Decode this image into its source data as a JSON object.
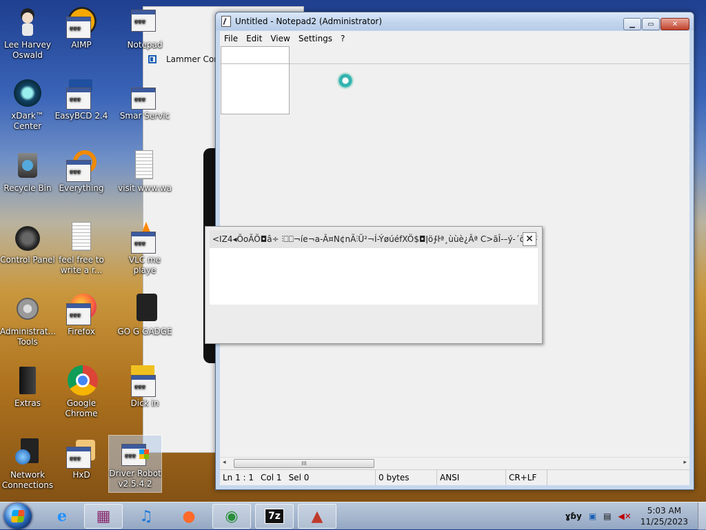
{
  "desktop": {
    "icons": [
      {
        "label": "Lee Harvey Oswald"
      },
      {
        "label": "AIMP"
      },
      {
        "label": "Notepad"
      },
      {
        "label": "xDark™ Center"
      },
      {
        "label": "EasyBCD 2.4"
      },
      {
        "label": "Smar Servic"
      },
      {
        "label": "Recycle Bin"
      },
      {
        "label": "Everything"
      },
      {
        "label": "visit www.wa"
      },
      {
        "label": "Control Panel"
      },
      {
        "label": "feel free to write a r..."
      },
      {
        "label": "VLC me playe"
      },
      {
        "label": "Administrat... Tools"
      },
      {
        "label": "Firefox"
      },
      {
        "label": "GO G GADGE"
      },
      {
        "label": "Extras"
      },
      {
        "label": "Google Chrome"
      },
      {
        "label": "Dick in"
      },
      {
        "label": "Network Connections"
      },
      {
        "label": "HxD"
      },
      {
        "label": "Driver Robot v2.5.4.2"
      }
    ]
  },
  "side_window": {
    "label": "Lammer Cont"
  },
  "notepad": {
    "title": "Untitled - Notepad2 (Administrator)",
    "menu": [
      "File",
      "Edit",
      "View",
      "Settings",
      "?"
    ],
    "window_buttons": {
      "minimize": "▁",
      "maximize": "▭",
      "close": "✕"
    },
    "scrollbar": {
      "left": "◂",
      "right": "▸",
      "grip": "III"
    },
    "status": {
      "position": "Ln 1 : 1",
      "col": "Col 1",
      "sel": "Sel 0",
      "size": "0 bytes",
      "encoding": "ANSI",
      "line_ending": "CR+LF"
    }
  },
  "overlay": {
    "text": "<IZ4◂ÕoÃÕ◘â÷  ⫶⎕⎕¬íe¬a-Â¤N¢nÃ⫶Ü²¬Í-ÝøúéfXÖ$◘ǀö∱ŀª¸ùùè¿Âª C>ãÎ-–ý-´öèc-î$...",
    "close": "✕"
  },
  "taskbar": {
    "items": [
      {
        "name": "internet-explorer",
        "glyph": "e"
      },
      {
        "name": "winrar",
        "glyph": "▦"
      },
      {
        "name": "music",
        "glyph": "♫"
      },
      {
        "name": "firefox",
        "glyph": "●"
      },
      {
        "name": "chrome",
        "glyph": "◉"
      },
      {
        "name": "7zip",
        "glyph": "7z"
      },
      {
        "name": "paint",
        "glyph": "▲"
      }
    ],
    "tray": {
      "lang": "ɣɓy",
      "time": "5:03 AM",
      "date": "11/25/2023"
    }
  },
  "colors": {
    "accent": "#1a5fb4",
    "titlebar": "#c4d6ee"
  }
}
